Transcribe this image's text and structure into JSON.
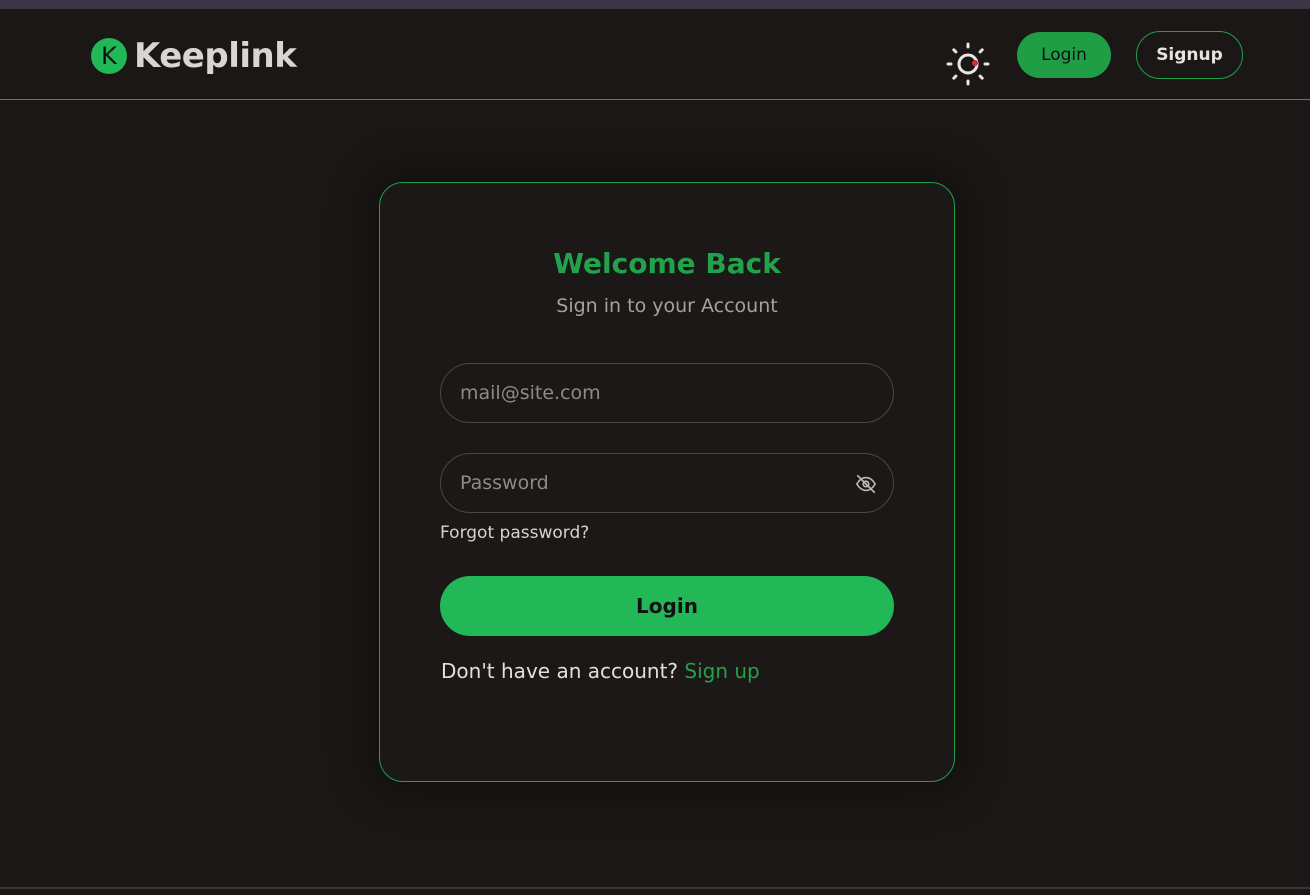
{
  "brand": {
    "logo_letter": "K",
    "name": "Keeplink",
    "logo_color": "#22b857"
  },
  "header": {
    "theme_toggle_icon": "sun-icon",
    "login_label": "Login",
    "signup_label": "Signup"
  },
  "login_form": {
    "title": "Welcome Back",
    "subtitle": "Sign in to your Account",
    "email_placeholder": "mail@site.com",
    "email_value": "",
    "password_placeholder": "Password",
    "password_value": "",
    "password_toggle_icon": "eye-off-icon",
    "forgot_password": "Forgot password?",
    "submit_label": "Login",
    "signup_prompt": "Don't have an account?",
    "signup_link": "Sign up"
  },
  "colors": {
    "accent": "#22b857",
    "accent_dark": "#21a04a",
    "background": "#1a1716",
    "toggle_dot": "#e0262e"
  }
}
